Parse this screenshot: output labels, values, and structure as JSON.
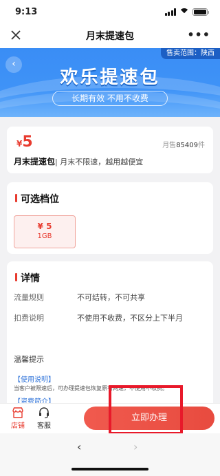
{
  "status_bar": {
    "time": "9:13"
  },
  "nav": {
    "title": "月末提速包",
    "more": "•••"
  },
  "banner": {
    "sale_range": "售卖范围：陕西",
    "title": "欢乐提速包",
    "subtitle": "长期有效 不用不收费",
    "back_glyph": "‹"
  },
  "product": {
    "currency": "¥",
    "price": "5",
    "monthly_sales_label": "月售",
    "monthly_sales_count": "85409",
    "monthly_sales_unit": "件",
    "name": "月末提速包",
    "description": "| 月末不限速，越用越便宜"
  },
  "tiers": {
    "title": "可选档位",
    "items": [
      {
        "price": "¥ 5",
        "data": "1GB"
      }
    ]
  },
  "details": {
    "title": "详情",
    "rows": [
      {
        "key": "流量规则",
        "value": "不可结转，不可共享"
      },
      {
        "key": "扣费说明",
        "value": "不使用不收费，不区分上下半月"
      }
    ],
    "tips_title": "温馨提示",
    "link_usage": "【使用说明】",
    "usage_text": "当客户被限速后，可办理提速包恢复原有网速，不使用不收费。",
    "link_intro": "【资费简介】"
  },
  "bottom_bar": {
    "store_label": "店铺",
    "service_label": "客服",
    "buy_label": "立即办理"
  },
  "browser": {
    "back": "‹",
    "forward": "›"
  },
  "colors": {
    "accent": "#e83b2f",
    "banner_blue": "#3f93f7",
    "highlight": "#e8192a"
  }
}
